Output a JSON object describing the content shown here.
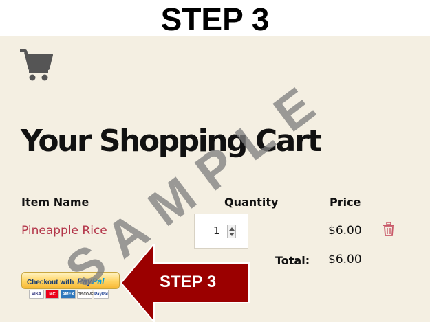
{
  "banner": {
    "title": "STEP 3"
  },
  "cart": {
    "title": "Your Shopping Cart",
    "columns": {
      "item": "Item Name",
      "quantity": "Quantity",
      "price": "Price"
    },
    "items": [
      {
        "name": "Pineapple Rice",
        "quantity": "1",
        "price": "$6.00"
      }
    ],
    "total_label": "Total:",
    "total_value": "$6.00"
  },
  "checkout": {
    "button_text": "Checkout with",
    "logo_pay": "Pay",
    "logo_pal": "Pal",
    "cards": [
      "VISA",
      "MC",
      "AMEX",
      "DISCOVER",
      "PayPal"
    ]
  },
  "annotation": {
    "arrow_label": "STEP 3"
  },
  "watermark": "SAMPLE",
  "icons": {
    "cart": "cart-icon",
    "trash": "trash-icon"
  },
  "colors": {
    "background": "#f4efe2",
    "link": "#b3364a",
    "arrow": "#9b0000",
    "trash": "#c95a6a"
  }
}
